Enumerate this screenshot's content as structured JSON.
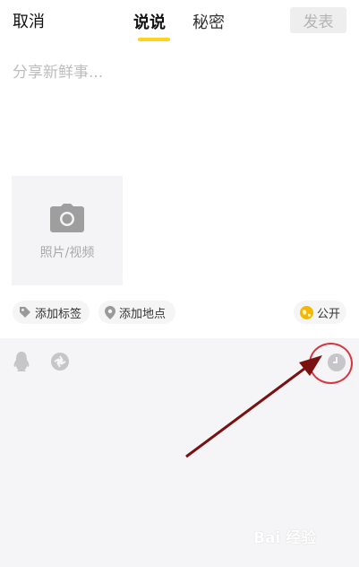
{
  "header": {
    "cancel_label": "取消",
    "tabs": [
      {
        "label": "说说",
        "active": true
      },
      {
        "label": "秘密",
        "active": false
      }
    ],
    "publish_label": "发表",
    "accent_color": "#ffd21e"
  },
  "composer": {
    "placeholder": "分享新鲜事..."
  },
  "media": {
    "add_label": "照片/视频",
    "icon": "camera-icon"
  },
  "chips": {
    "tag": {
      "label": "添加标签",
      "icon": "tag-icon"
    },
    "location": {
      "label": "添加地点",
      "icon": "location-pin-icon"
    },
    "visibility": {
      "label": "公开",
      "icon": "globe-icon"
    }
  },
  "toolbar": {
    "icons": [
      "qq-penguin-icon",
      "camera-shutter-icon",
      "clock-icon"
    ]
  },
  "annotation": {
    "color": "#d9353d",
    "arrow_color": "#7a1010"
  },
  "watermark": {
    "text": "Bai 经验"
  }
}
